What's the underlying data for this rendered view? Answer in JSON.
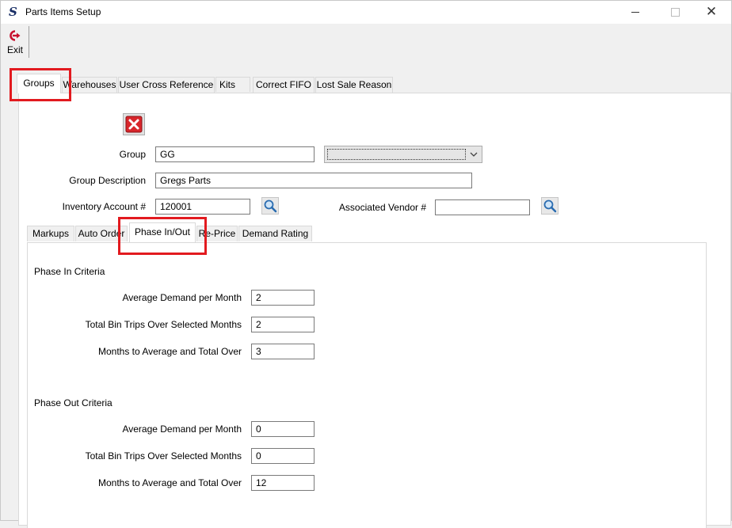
{
  "window": {
    "title": "Parts Items Setup"
  },
  "toolbar": {
    "exit_label": "Exit"
  },
  "main_tabs": [
    {
      "label": "Groups",
      "active": true
    },
    {
      "label": "Warehouses",
      "active": false
    },
    {
      "label": "User Cross Reference",
      "active": false
    },
    {
      "label": "Kits",
      "active": false
    },
    {
      "label": "Correct FIFO",
      "active": false
    },
    {
      "label": "Lost Sale Reason",
      "active": false
    }
  ],
  "groups": {
    "group_label": "Group",
    "group_value": "GG",
    "group_combo_value": "",
    "description_label": "Group Description",
    "description_value": "Gregs Parts",
    "inventory_account_label": "Inventory Account #",
    "inventory_account_value": "120001",
    "vendor_label": "Associated Vendor #",
    "vendor_value": ""
  },
  "sub_tabs": [
    {
      "label": "Markups",
      "active": false
    },
    {
      "label": "Auto Order",
      "active": false
    },
    {
      "label": "Phase In/Out",
      "active": true
    },
    {
      "label": "Re-Price",
      "active": false
    },
    {
      "label": "Demand Rating",
      "active": false
    }
  ],
  "phase_in": {
    "title": "Phase In Criteria",
    "fields": [
      {
        "label": "Average Demand per Month",
        "value": "2"
      },
      {
        "label": "Total Bin Trips Over Selected Months",
        "value": "2"
      },
      {
        "label": "Months to Average and Total Over",
        "value": "3"
      }
    ]
  },
  "phase_out": {
    "title": "Phase Out Criteria",
    "fields": [
      {
        "label": "Average Demand per Month",
        "value": "0"
      },
      {
        "label": "Total Bin Trips Over Selected Months",
        "value": "0"
      },
      {
        "label": "Months to Average and Total Over",
        "value": "12"
      }
    ]
  },
  "colors": {
    "highlight_box": "#e21a1f",
    "exit_icon": "#c8102e"
  }
}
